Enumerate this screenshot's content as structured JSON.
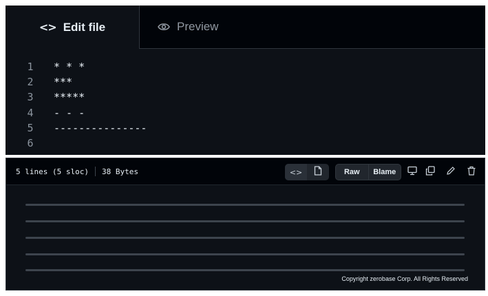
{
  "tabs": {
    "edit": {
      "label": "Edit file",
      "icon": "code-icon"
    },
    "preview": {
      "label": "Preview",
      "icon": "eye-icon"
    }
  },
  "code_lines": [
    {
      "num": "1",
      "text": "* * *"
    },
    {
      "num": "2",
      "text": "***"
    },
    {
      "num": "3",
      "text": "*****"
    },
    {
      "num": "4",
      "text": "- - -"
    },
    {
      "num": "5",
      "text": "---------------"
    },
    {
      "num": "6",
      "text": ""
    }
  ],
  "viewer": {
    "lines_info": "5 lines (5 sloc)",
    "size": "38 Bytes",
    "raw_label": "Raw",
    "blame_label": "Blame",
    "icons": [
      "code-icon",
      "file-icon",
      "desktop-icon",
      "copy-icon",
      "pencil-icon",
      "trash-icon"
    ],
    "copyright": "Copyright zerobase Corp. All Rights Reserved"
  },
  "colors": {
    "background": "#0d1117",
    "tabbar": "#010409",
    "text": "#e6edf3",
    "muted": "#8b949e",
    "border": "#30363d"
  }
}
